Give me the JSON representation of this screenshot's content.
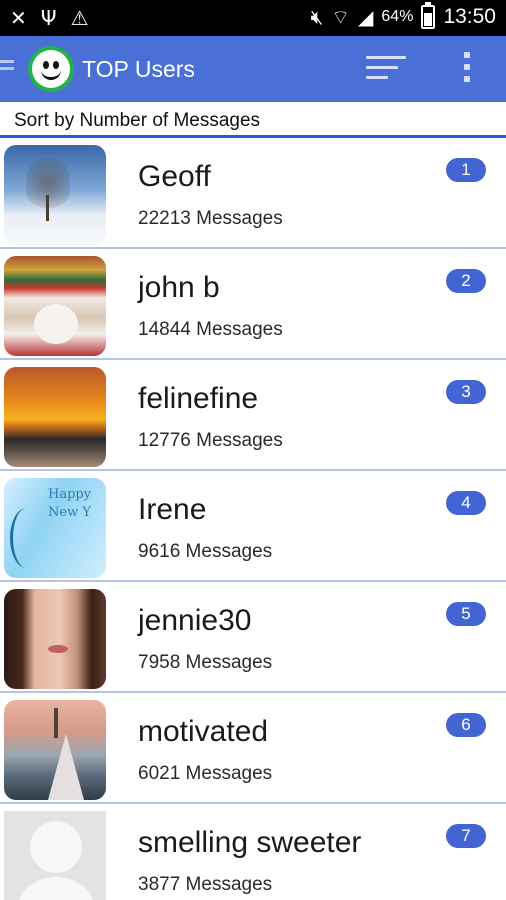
{
  "status_bar": {
    "left_icons": [
      "missed-call-icon",
      "usb-icon",
      "warning-icon"
    ],
    "right_icons": [
      "mute-icon",
      "wifi-icon",
      "signal-icon"
    ],
    "battery_percent": "64%",
    "battery_level": 0.64,
    "time": "13:50"
  },
  "app_bar": {
    "title": "TOP Users",
    "accent_color": "#4a6fd6"
  },
  "sort_header": {
    "label": "Sort by Number of Messages"
  },
  "users": [
    {
      "rank": "1",
      "name": "Geoff",
      "messages": "22213 Messages",
      "avatar": "winter-tree"
    },
    {
      "rank": "2",
      "name": "john b",
      "messages": "14844 Messages",
      "avatar": "santa"
    },
    {
      "rank": "3",
      "name": "felinefine",
      "messages": "12776 Messages",
      "avatar": "sunset"
    },
    {
      "rank": "4",
      "name": "Irene",
      "messages": "9616 Messages",
      "avatar": "new-year-card"
    },
    {
      "rank": "5",
      "name": "jennie30",
      "messages": "7958 Messages",
      "avatar": "selfie"
    },
    {
      "rank": "6",
      "name": "motivated",
      "messages": "6021 Messages",
      "avatar": "path-landscape"
    },
    {
      "rank": "7",
      "name": "smelling sweeter",
      "messages": "3877 Messages",
      "avatar": "default-avatar"
    }
  ]
}
